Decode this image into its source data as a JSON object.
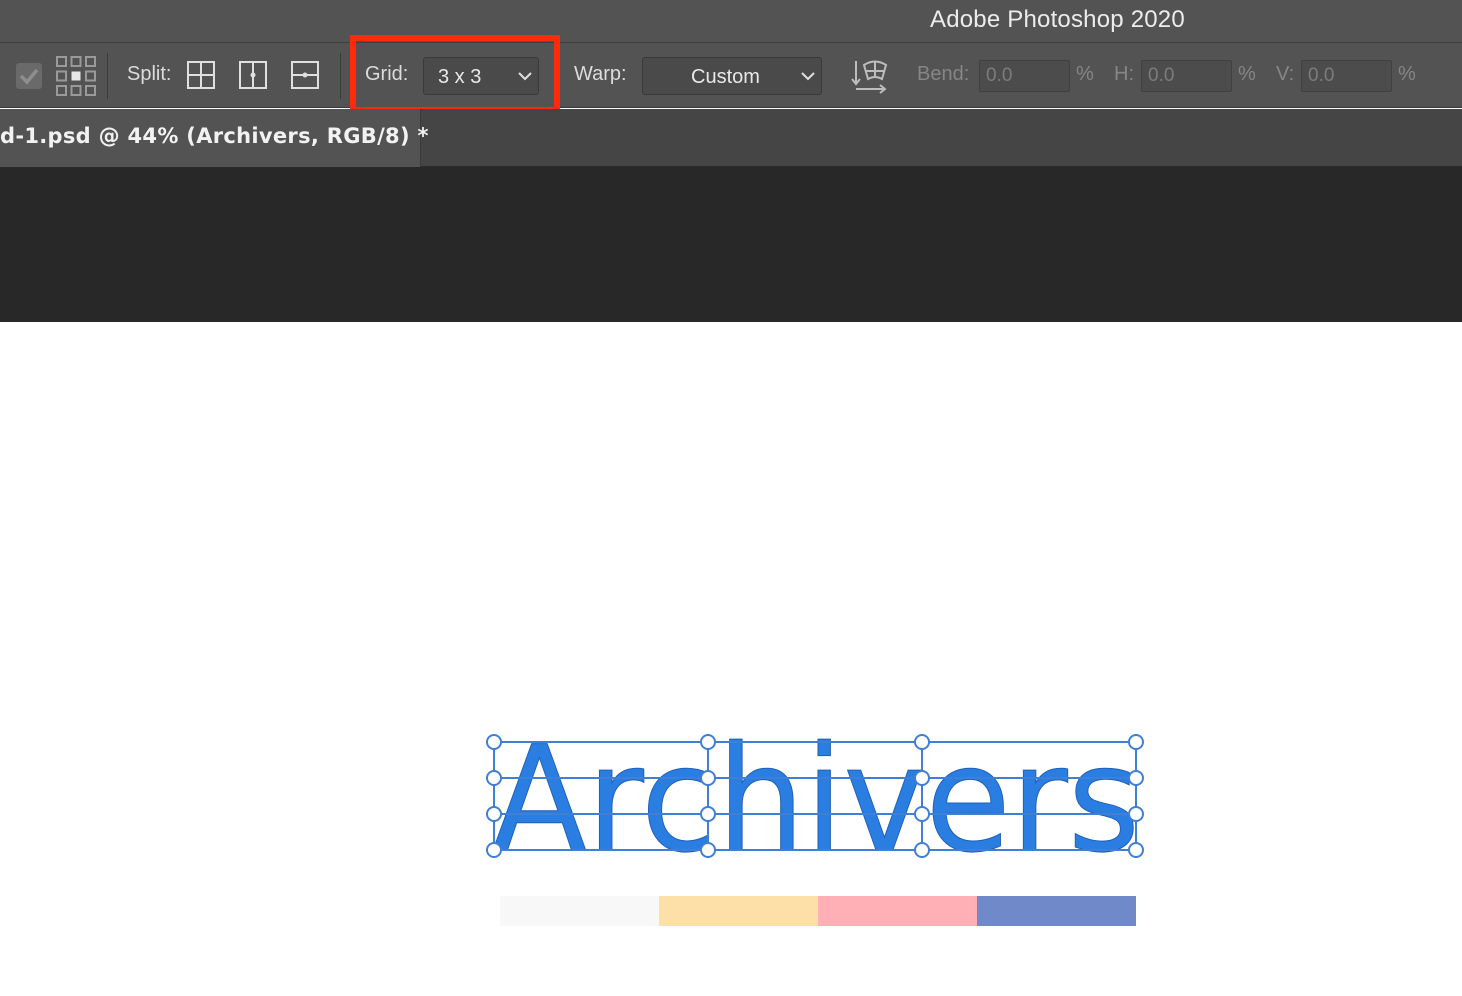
{
  "app": {
    "title": "Adobe Photoshop 2020"
  },
  "options": {
    "split_label": "Split:",
    "grid_label": "Grid:",
    "grid_value": "3 x 3",
    "warp_label": "Warp:",
    "warp_value": "Custom",
    "bend_label": "Bend:",
    "bend_value": "0.0",
    "h_label": "H:",
    "h_value": "0.0",
    "v_label": "V:",
    "v_value": "0.0",
    "percent": "%"
  },
  "document": {
    "tab_label": "d-1.psd @ 44% (Archivers, RGB/8) *"
  },
  "canvas": {
    "text": "Archivers",
    "text_color": "#2a7de1",
    "swatches": [
      "#f8f8f8",
      "#fde0a8",
      "#ffafb5",
      "#6f89c9"
    ]
  },
  "colors": {
    "highlight": "#ff2a0a",
    "panel": "#535353",
    "workspace": "#282828",
    "warp_grid": "#3f7fd6"
  }
}
